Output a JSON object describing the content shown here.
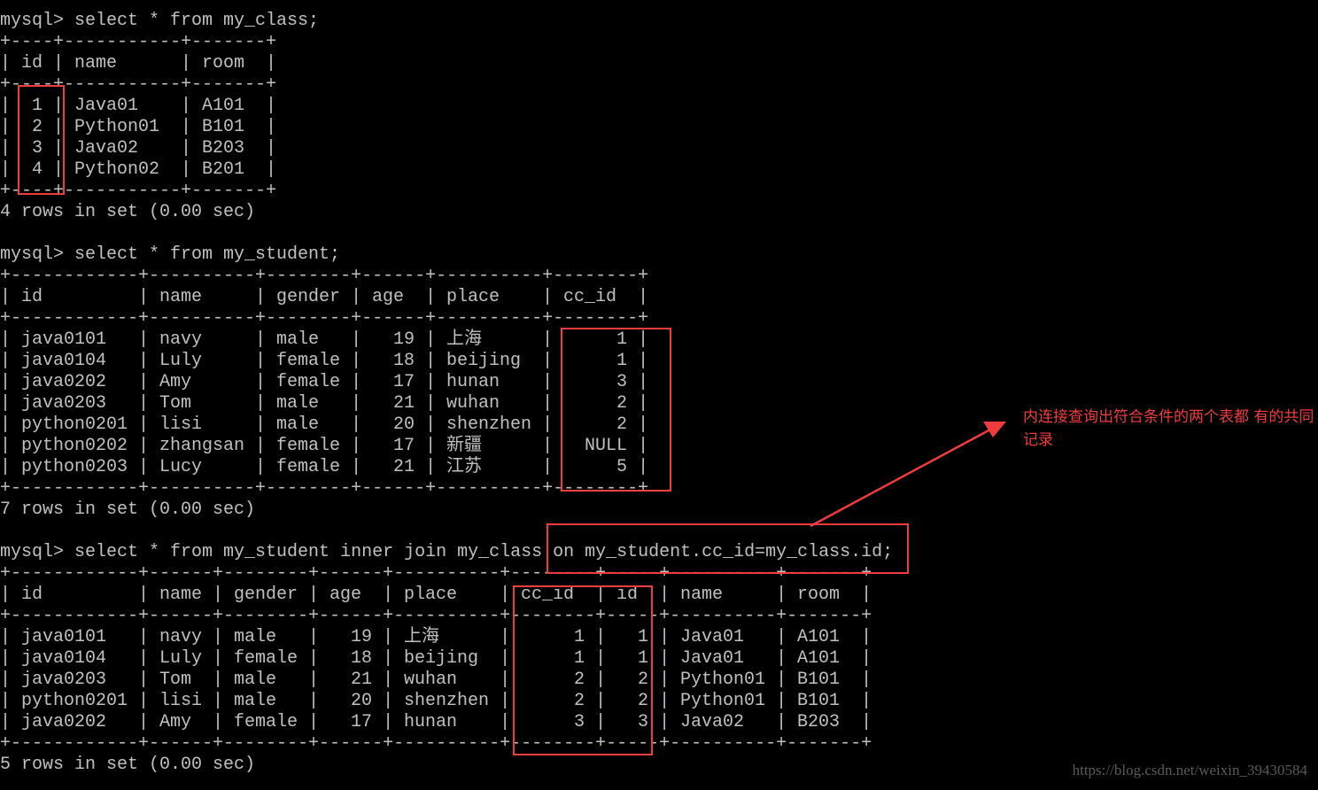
{
  "commands": [
    "mysql> select * from my_class;",
    "mysql> select * from my_student;",
    "mysql> select * from my_student inner join my_class on my_student.cc_id=my_class.id;"
  ],
  "class_table": {
    "headers": [
      "id",
      "name",
      "room"
    ],
    "rows": [
      [
        "1",
        "Java01",
        "A101"
      ],
      [
        "2",
        "Python01",
        "B101"
      ],
      [
        "3",
        "Java02",
        "B203"
      ],
      [
        "4",
        "Python02",
        "B201"
      ]
    ],
    "result": "4 rows in set (0.00 sec)"
  },
  "student_table": {
    "headers": [
      "id",
      "name",
      "gender",
      "age",
      "place",
      "cc_id"
    ],
    "rows": [
      [
        "java0101",
        "navy",
        "male",
        "19",
        "上海",
        "1"
      ],
      [
        "java0104",
        "Luly",
        "female",
        "18",
        "beijing",
        "1"
      ],
      [
        "java0202",
        "Amy",
        "female",
        "17",
        "hunan",
        "3"
      ],
      [
        "java0203",
        "Tom",
        "male",
        "21",
        "wuhan",
        "2"
      ],
      [
        "python0201",
        "lisi",
        "male",
        "20",
        "shenzhen",
        "2"
      ],
      [
        "python0202",
        "zhangsan",
        "female",
        "17",
        "新疆",
        "NULL"
      ],
      [
        "python0203",
        "Lucy",
        "female",
        "21",
        "江苏",
        "5"
      ]
    ],
    "result": "7 rows in set (0.00 sec)"
  },
  "join_table": {
    "headers": [
      "id",
      "name",
      "gender",
      "age",
      "place",
      "cc_id",
      "id",
      "name",
      "room"
    ],
    "rows": [
      [
        "java0101",
        "navy",
        "male",
        "19",
        "上海",
        "1",
        "1",
        "Java01",
        "A101"
      ],
      [
        "java0104",
        "Luly",
        "female",
        "18",
        "beijing",
        "1",
        "1",
        "Java01",
        "A101"
      ],
      [
        "java0203",
        "Tom",
        "male",
        "21",
        "wuhan",
        "2",
        "2",
        "Python01",
        "B101"
      ],
      [
        "python0201",
        "lisi",
        "male",
        "20",
        "shenzhen",
        "2",
        "2",
        "Python01",
        "B101"
      ],
      [
        "java0202",
        "Amy",
        "female",
        "17",
        "hunan",
        "3",
        "3",
        "Java02",
        "B203"
      ]
    ],
    "result": "5 rows in set (0.00 sec)"
  },
  "annotation": "内连接查询出符合条件的两个表都 有的共同记录",
  "watermark": "https://blog.csdn.net/weixin_39430584",
  "colors": {
    "highlight": "#f03c3c",
    "text": "#c0c0c0",
    "background": "#000000"
  }
}
